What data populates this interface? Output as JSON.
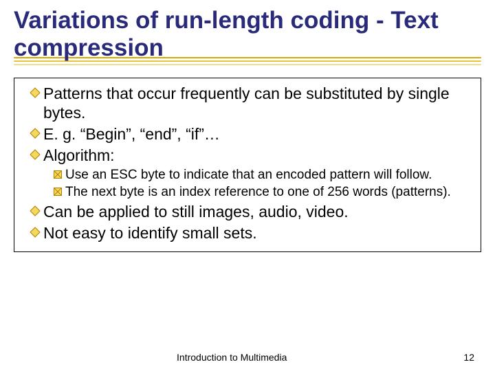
{
  "title": "Variations of run-length coding - Text compression",
  "bullets": {
    "b1": "Patterns that occur frequently can be substituted by single bytes.",
    "b2": "E. g. “Begin”, “end”, “if”…",
    "b3": "Algorithm:",
    "b3a": "Use an ESC byte to indicate that an encoded pattern will follow.",
    "b3b": "The next byte is an index reference to one of 256 words (patterns).",
    "b4": "Can be applied to still images, audio, video.",
    "b5": "Not easy to identify small sets."
  },
  "footer": {
    "center": "Introduction to Multimedia",
    "page": "12"
  },
  "colors": {
    "title": "#2a2a7a",
    "bullet1_fill": "#f4d860",
    "bullet1_stroke": "#b08000",
    "bullet2_fill": "#f4d860",
    "bullet2_stroke": "#b08000"
  }
}
